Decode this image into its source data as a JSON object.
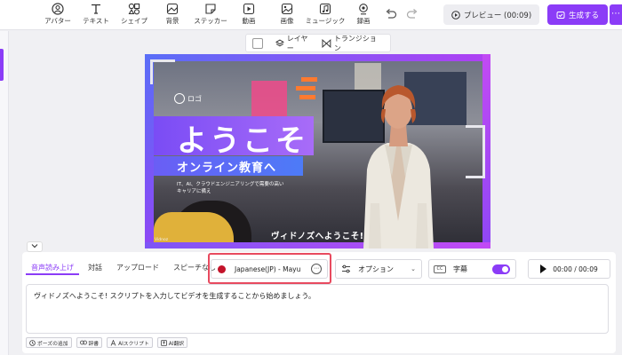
{
  "toolbar": {
    "tools": [
      {
        "label": "アバター",
        "icon": "avatar-icon"
      },
      {
        "label": "テキスト",
        "icon": "text-icon"
      },
      {
        "label": "シェイプ",
        "icon": "shape-icon"
      },
      {
        "label": "背景",
        "icon": "background-icon"
      },
      {
        "label": "ステッカー",
        "icon": "sticker-icon"
      },
      {
        "label": "動画",
        "icon": "video-icon"
      },
      {
        "label": "画像",
        "icon": "image-icon"
      },
      {
        "label": "ミュージック",
        "icon": "music-icon"
      },
      {
        "label": "録画",
        "icon": "record-icon"
      }
    ],
    "preview_label": "プレビュー (00:09)",
    "generate_label": "生成する",
    "more_label": "⋯"
  },
  "canvas_tools": {
    "layer_label": "レイヤー",
    "transition_label": "トランジション"
  },
  "video": {
    "logo_label": "ロゴ",
    "title": "ようこそ",
    "subtitle": "オンライン教育へ",
    "small_line1": "IT、AI、クラウドエンジニアリングで需要の高い",
    "small_line2": "キャリアに備え",
    "caption": "ヴィドノズへようこそ!",
    "watermark": "Vidnoz"
  },
  "panel": {
    "tabs": [
      "音声読み上げ",
      "対話",
      "アップロード",
      "スピーチなし"
    ],
    "active_tab": "音声読み上げ",
    "voice_label": "Japanese(JP) - Mayu",
    "voice_more": "⋯",
    "option_label": "オプション",
    "subtitle_label": "字幕",
    "subtitle_on": true,
    "time_label": "00:00 / 00:09",
    "script_text": "ヴィドノズへようこそ! スクリプトを入力してビデオを生成することから始めましょう。",
    "chips": [
      {
        "label": "ポーズの追加",
        "icon": "clock-icon"
      },
      {
        "label": "辞書",
        "icon": "link-icon"
      },
      {
        "label": "AIスクリプト",
        "icon": "ai-script-icon"
      },
      {
        "label": "AI翻訳",
        "icon": "translate-icon"
      }
    ]
  },
  "colors": {
    "accent": "#8b3cf7",
    "highlight_box": "#e84a5f",
    "voice_flag": "#c3132a"
  }
}
